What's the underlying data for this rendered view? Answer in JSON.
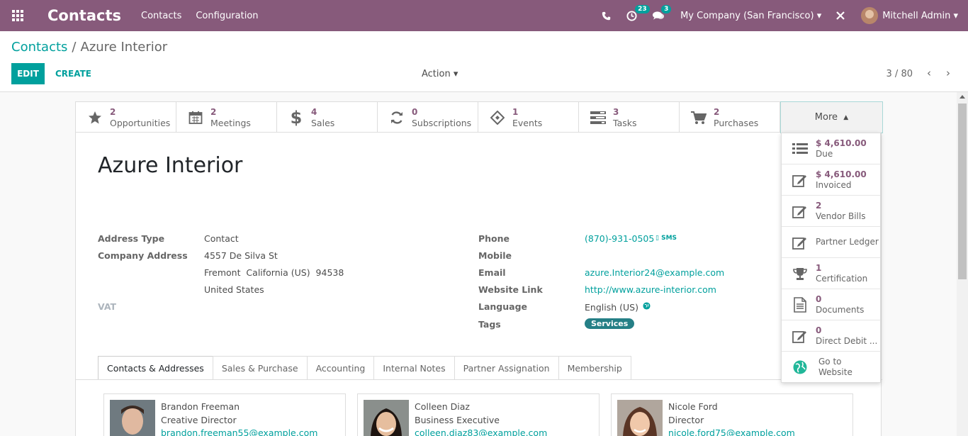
{
  "navbar": {
    "brand": "Contacts",
    "menu": [
      "Contacts",
      "Configuration"
    ],
    "activity_count": "23",
    "message_count": "3",
    "company": "My Company (San Francisco)",
    "user": "Mitchell Admin",
    "bg_color": "#875a7b"
  },
  "control": {
    "breadcrumb_parent": "Contacts",
    "breadcrumb_sep": "/",
    "breadcrumb_current": "Azure Interior",
    "edit_label": "EDIT",
    "create_label": "CREATE",
    "action_label": "Action",
    "pager": "3 / 80",
    "accent": "#00a09d"
  },
  "stats": [
    {
      "num": "2",
      "label": "Opportunities",
      "icon": "star-icon"
    },
    {
      "num": "2",
      "label": "Meetings",
      "icon": "calendar-icon"
    },
    {
      "num": "4",
      "label": "Sales",
      "icon": "dollar-icon"
    },
    {
      "num": "0",
      "label": "Subscriptions",
      "icon": "refresh-icon"
    },
    {
      "num": "1",
      "label": "Events",
      "icon": "ticket-icon"
    },
    {
      "num": "3",
      "label": "Tasks",
      "icon": "tasks-icon"
    },
    {
      "num": "2",
      "label": "Purchases",
      "icon": "cart-icon"
    }
  ],
  "more_label": "More",
  "dropdown": [
    {
      "num": "$ 4,610.00",
      "label": "Due",
      "icon": "list-icon"
    },
    {
      "num": "$ 4,610.00",
      "label": "Invoiced",
      "icon": "edit-icon"
    },
    {
      "num": "2",
      "label": "Vendor Bills",
      "icon": "edit-icon"
    },
    {
      "num": "",
      "label": "Partner Ledger",
      "icon": "edit-icon"
    },
    {
      "num": "1",
      "label": "Certification",
      "icon": "trophy-icon"
    },
    {
      "num": "0",
      "label": "Documents",
      "icon": "document-icon"
    },
    {
      "num": "0",
      "label": "Direct Debit ...",
      "icon": "edit-icon"
    },
    {
      "num": "Go to",
      "label": "Website",
      "icon": "globe-icon"
    }
  ],
  "record": {
    "name": "Azure Interior",
    "address_type_label": "Address Type",
    "address_type": "Contact",
    "company_address_label": "Company Address",
    "street": "4557 De Silva St",
    "city_line": "Fremont  California (US)  94538",
    "country": "United States",
    "vat_label": "VAT",
    "phone_label": "Phone",
    "phone": "(870)-931-0505",
    "sms_label": "SMS",
    "mobile_label": "Mobile",
    "email_label": "Email",
    "email": "azure.Interior24@example.com",
    "website_label": "Website Link",
    "website": "http://www.azure-interior.com",
    "language_label": "Language",
    "language": "English (US)",
    "tags_label": "Tags",
    "tag": "Services"
  },
  "tabs": [
    "Contacts & Addresses",
    "Sales & Purchase",
    "Accounting",
    "Internal Notes",
    "Partner Assignation",
    "Membership"
  ],
  "contacts": [
    {
      "name": "Brandon Freeman",
      "job": "Creative Director",
      "email": "brandon.freeman55@example.com"
    },
    {
      "name": "Colleen Diaz",
      "job": "Business Executive",
      "email": "colleen.diaz83@example.com"
    },
    {
      "name": "Nicole Ford",
      "job": "Director",
      "email": "nicole.ford75@example.com"
    }
  ]
}
